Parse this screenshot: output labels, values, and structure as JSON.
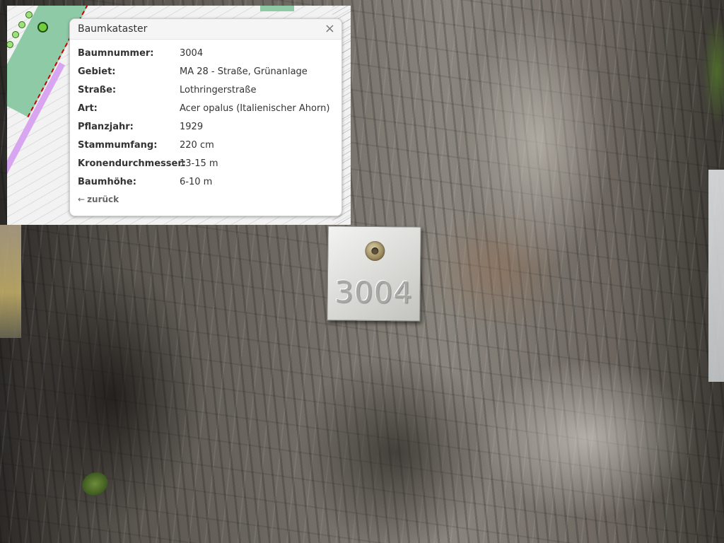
{
  "popup": {
    "title": "Baumkataster",
    "close_icon": "×",
    "rows": [
      {
        "label": "Baumnummer:",
        "value": "3004"
      },
      {
        "label": "Gebiet:",
        "value": "MA 28 - Straße, Grünanlage"
      },
      {
        "label": "Straße:",
        "value": "Lothringerstraße"
      },
      {
        "label": "Art:",
        "value": "Acer opalus (Italienischer Ahorn)"
      },
      {
        "label": "Pflanzjahr:",
        "value": "1929"
      },
      {
        "label": "Stammumfang:",
        "value": "220 cm"
      },
      {
        "label": "Kronendurchmesser:",
        "value": "13-15 m"
      },
      {
        "label": "Baumhöhe:",
        "value": "6-10 m"
      }
    ],
    "back_arrow": "←",
    "back_label": "zurück"
  },
  "tag": {
    "number": "3004"
  },
  "colors": {
    "map_green": "#8fcaa7",
    "map_red_outline": "#cc0000",
    "map_purple": "#d8a6f0",
    "tree_marker": "#9fe07a"
  }
}
